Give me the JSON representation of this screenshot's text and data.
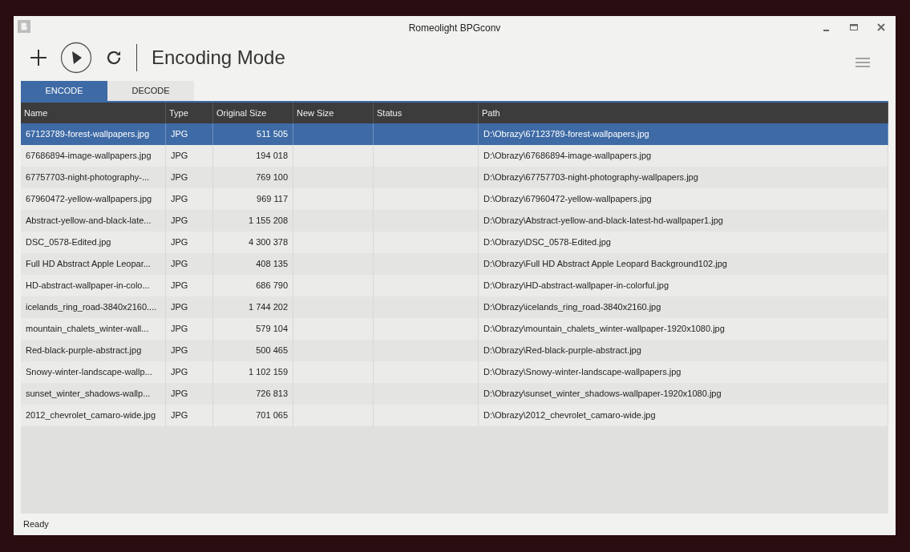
{
  "window": {
    "title": "Romeolight BPGconv"
  },
  "toolbar": {
    "mode_title": "Encoding Mode"
  },
  "tabs": [
    {
      "label": "ENCODE",
      "selected": true
    },
    {
      "label": "DECODE",
      "selected": false
    }
  ],
  "table": {
    "columns": [
      "Name",
      "Type",
      "Original Size",
      "New Size",
      "Status",
      "Path"
    ],
    "rows": [
      {
        "name": "67123789-forest-wallpapers.jpg",
        "type": "JPG",
        "original_size": "511 505",
        "path": "D:\\Obrazy\\67123789-forest-wallpapers.jpg",
        "selected": true
      },
      {
        "name": "67686894-image-wallpapers.jpg",
        "type": "JPG",
        "original_size": "194 018",
        "path": "D:\\Obrazy\\67686894-image-wallpapers.jpg",
        "selected": false
      },
      {
        "name": "67757703-night-photography-...",
        "type": "JPG",
        "original_size": "769 100",
        "path": "D:\\Obrazy\\67757703-night-photography-wallpapers.jpg",
        "selected": false
      },
      {
        "name": "67960472-yellow-wallpapers.jpg",
        "type": "JPG",
        "original_size": "969 117",
        "path": "D:\\Obrazy\\67960472-yellow-wallpapers.jpg",
        "selected": false
      },
      {
        "name": "Abstract-yellow-and-black-late...",
        "type": "JPG",
        "original_size": "1 155 208",
        "path": "D:\\Obrazy\\Abstract-yellow-and-black-latest-hd-wallpaper1.jpg",
        "selected": false
      },
      {
        "name": "DSC_0578-Edited.jpg",
        "type": "JPG",
        "original_size": "4 300 378",
        "path": "D:\\Obrazy\\DSC_0578-Edited.jpg",
        "selected": false
      },
      {
        "name": "Full HD Abstract Apple Leopar...",
        "type": "JPG",
        "original_size": "408 135",
        "path": "D:\\Obrazy\\Full HD Abstract Apple Leopard Background102.jpg",
        "selected": false
      },
      {
        "name": "HD-abstract-wallpaper-in-colo...",
        "type": "JPG",
        "original_size": "686 790",
        "path": "D:\\Obrazy\\HD-abstract-wallpaper-in-colorful.jpg",
        "selected": false
      },
      {
        "name": "icelands_ring_road-3840x2160....",
        "type": "JPG",
        "original_size": "1 744 202",
        "path": "D:\\Obrazy\\icelands_ring_road-3840x2160.jpg",
        "selected": false
      },
      {
        "name": "mountain_chalets_winter-wall...",
        "type": "JPG",
        "original_size": "579 104",
        "path": "D:\\Obrazy\\mountain_chalets_winter-wallpaper-1920x1080.jpg",
        "selected": false
      },
      {
        "name": "Red-black-purple-abstract.jpg",
        "type": "JPG",
        "original_size": "500 465",
        "path": "D:\\Obrazy\\Red-black-purple-abstract.jpg",
        "selected": false
      },
      {
        "name": "Snowy-winter-landscape-wallp...",
        "type": "JPG",
        "original_size": "1 102 159",
        "path": "D:\\Obrazy\\Snowy-winter-landscape-wallpapers.jpg",
        "selected": false
      },
      {
        "name": "sunset_winter_shadows-wallp...",
        "type": "JPG",
        "original_size": "726 813",
        "path": "D:\\Obrazy\\sunset_winter_shadows-wallpaper-1920x1080.jpg",
        "selected": false
      },
      {
        "name": "2012_chevrolet_camaro-wide.jpg",
        "type": "JPG",
        "original_size": "701 065",
        "path": "D:\\Obrazy\\2012_chevrolet_camaro-wide.jpg",
        "selected": false
      }
    ]
  },
  "status_bar": {
    "text": "Ready"
  }
}
